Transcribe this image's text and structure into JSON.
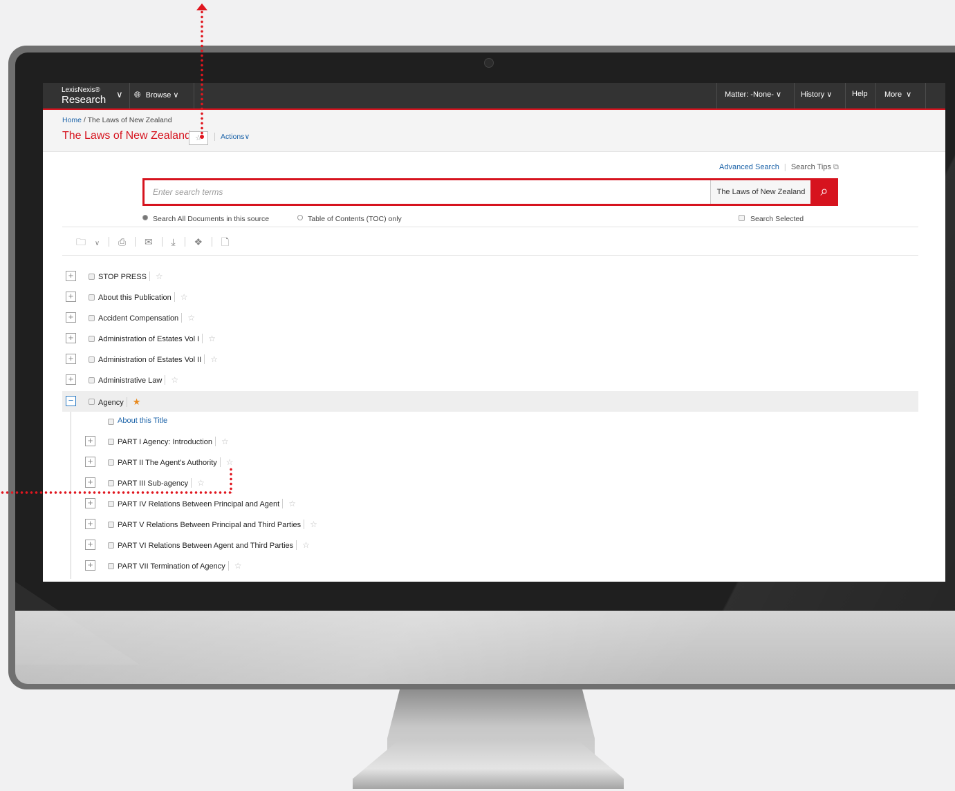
{
  "brand": {
    "small": "LexisNexis®",
    "big": "Research"
  },
  "nav": {
    "browse": "Browse",
    "matter": "Matter: -None-",
    "history": "History",
    "help": "Help",
    "more": "More"
  },
  "breadcrumb": {
    "home": "Home",
    "sep": "/",
    "current": "The Laws of New Zealand"
  },
  "title": "The Laws of New Zealand",
  "actions": "Actions",
  "search": {
    "advanced": "Advanced Search",
    "tips": "Search Tips",
    "placeholder": "Enter search terms",
    "scope": "The Laws of New Zealand",
    "option_all": "Search All Documents in this source",
    "option_toc": "Table of Contents (TOC) only",
    "search_selected": "Search Selected"
  },
  "tree": {
    "top": [
      {
        "label": "STOP PRESS"
      },
      {
        "label": "About this Publication"
      },
      {
        "label": "Accident Compensation"
      },
      {
        "label": "Administration of Estates Vol I"
      },
      {
        "label": "Administration of Estates Vol II"
      },
      {
        "label": "Administrative Law"
      },
      {
        "label": "Agency",
        "expanded": true,
        "favorite": true
      }
    ],
    "about_title": "About this Title",
    "children": [
      {
        "label": "PART I Agency: Introduction"
      },
      {
        "label": "PART II The Agent's Authority"
      },
      {
        "label": "PART III Sub-agency"
      },
      {
        "label": "PART IV Relations Between Principal and Agent"
      },
      {
        "label": "PART V Relations Between Principal and Third Parties"
      },
      {
        "label": "PART VI Relations Between Agent and Third Parties"
      },
      {
        "label": "PART VII Termination of Agency"
      }
    ]
  },
  "colors": {
    "accent": "#d6131e",
    "link": "#1a62a8",
    "favorite": "#e8891c",
    "navbar": "#333333"
  }
}
